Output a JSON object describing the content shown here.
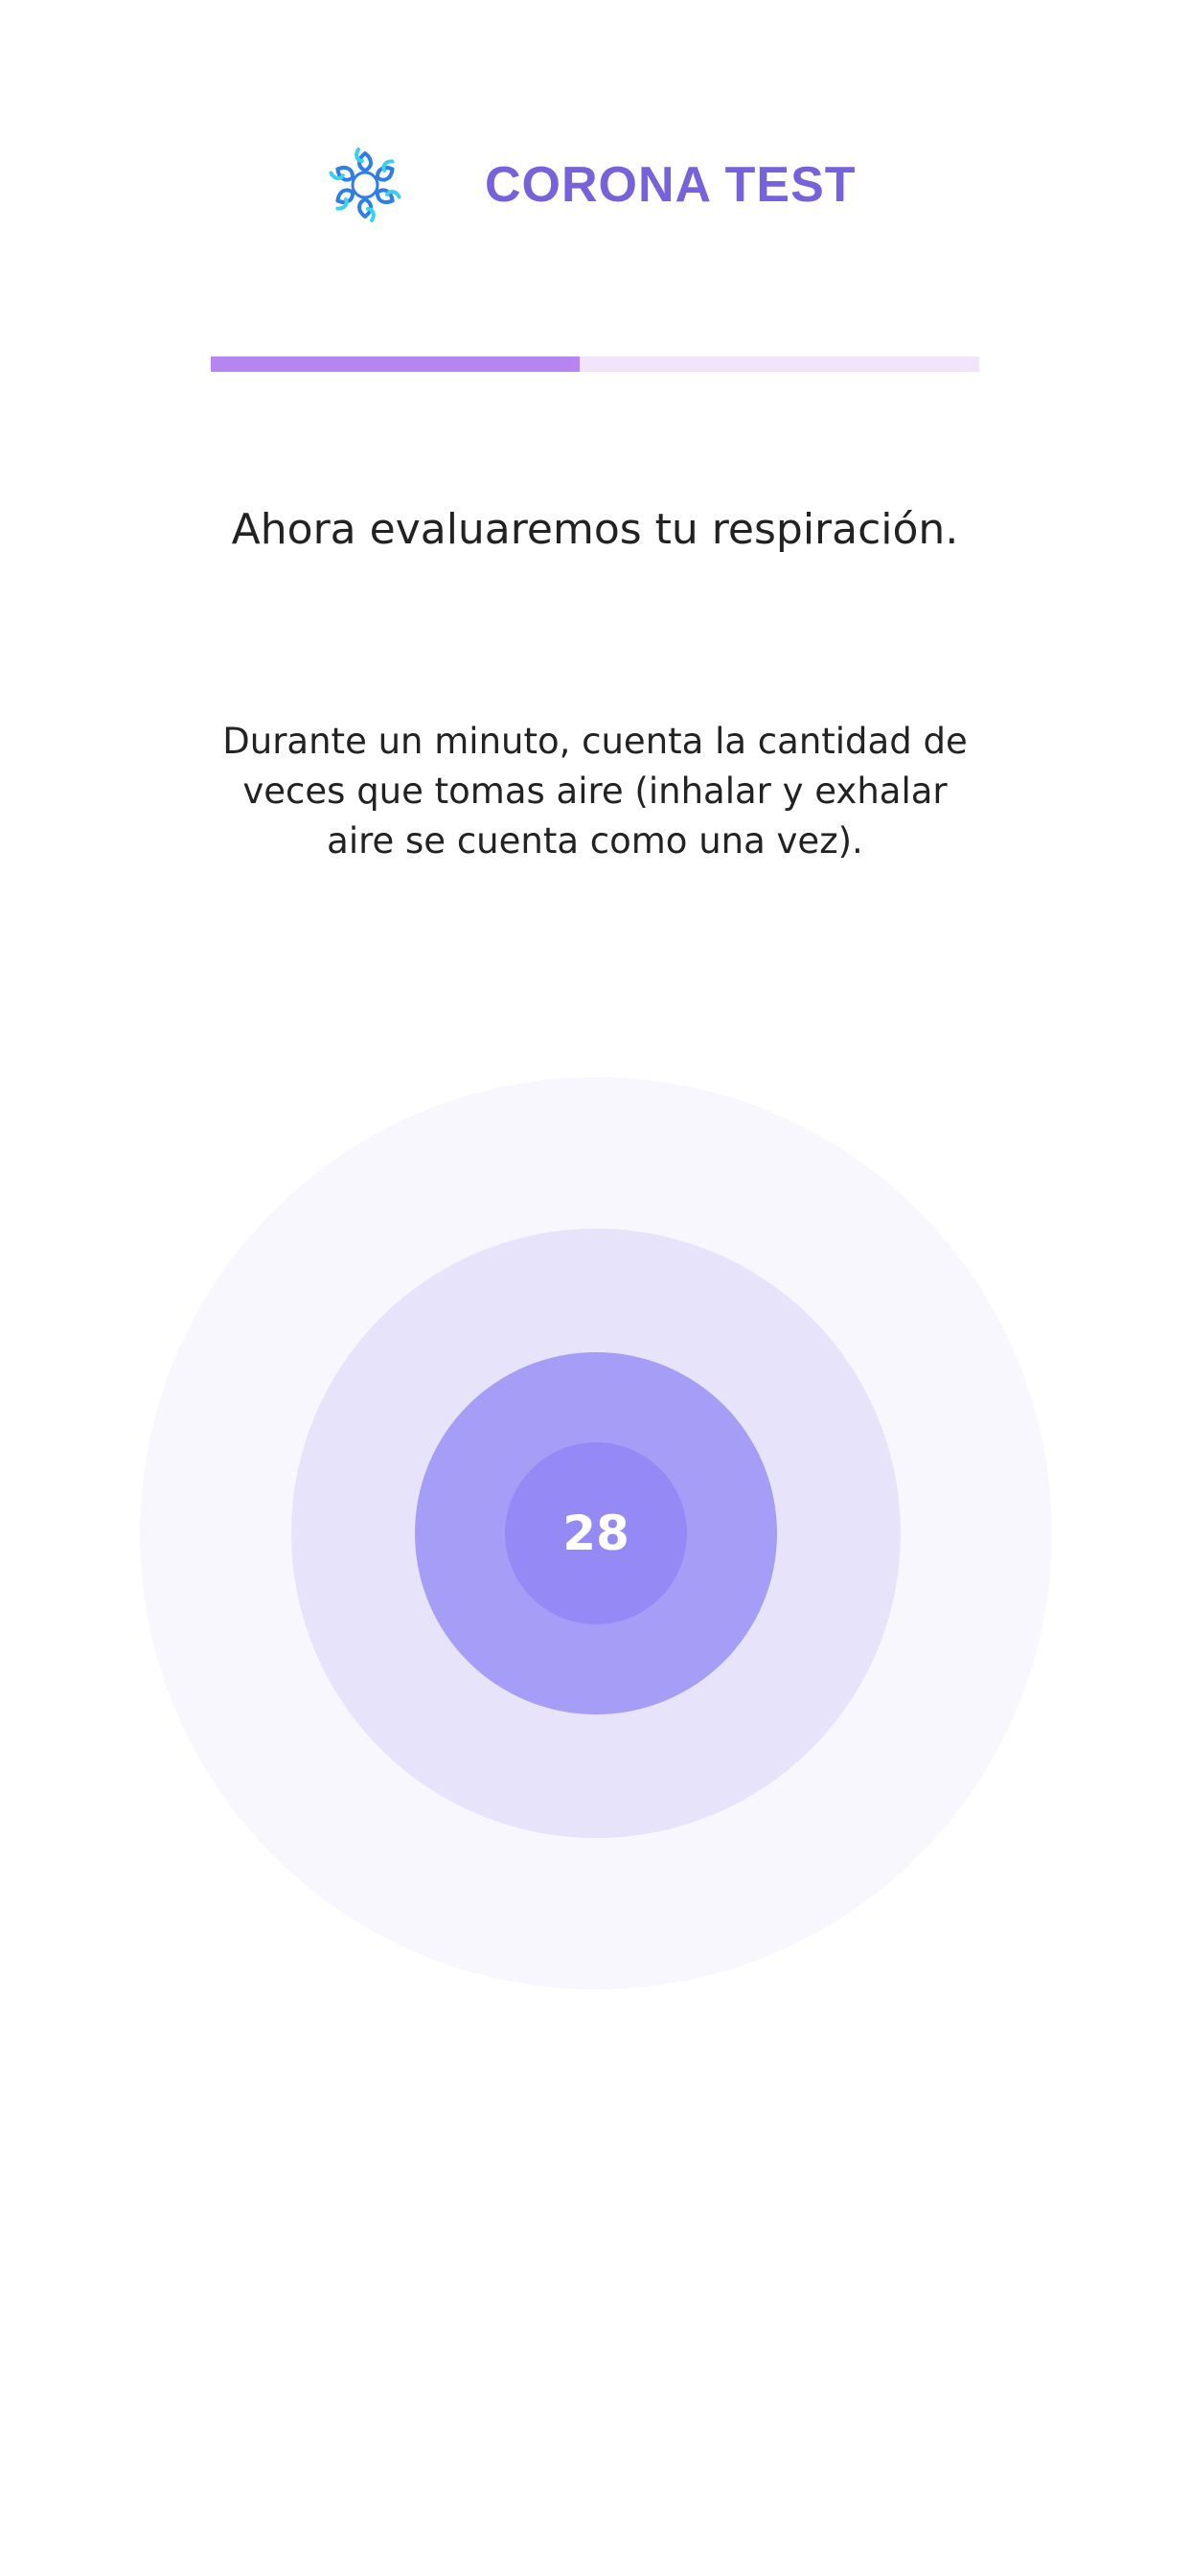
{
  "header": {
    "logo_icon": "virus-molecule-icon",
    "title": "CORONA TEST",
    "brand_color": "#7663db"
  },
  "progress": {
    "fraction": 0.48,
    "fill_color": "#b685f1",
    "track_color": "#f1e4fb"
  },
  "main": {
    "heading": "Ahora evaluaremos tu respiración.",
    "instructions": "Durante un minuto, cuenta la cantidad de veces que tomas aire (inhalar y exhalar aire se cuenta como una vez)."
  },
  "breath_counter": {
    "count": "28",
    "colors": [
      "#f8f7fe",
      "#e6e3fb",
      "#a69ef6",
      "#958af5"
    ]
  }
}
